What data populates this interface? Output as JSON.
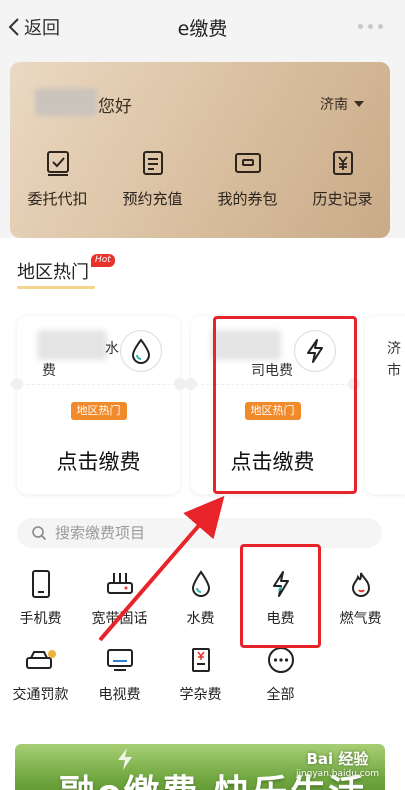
{
  "nav": {
    "back_label": "返回",
    "title": "e缴费"
  },
  "hero": {
    "greeting": "您好",
    "city": "济南",
    "actions": [
      {
        "label": "委托代扣",
        "icon": "check-box-icon"
      },
      {
        "label": "预约充值",
        "icon": "document-icon"
      },
      {
        "label": "我的券包",
        "icon": "coupon-icon"
      },
      {
        "label": "历史记录",
        "icon": "yen-record-icon"
      }
    ]
  },
  "section": {
    "title": "地区热门",
    "hot_tag": "Hot"
  },
  "cards": [
    {
      "name_a": "水",
      "name_b": "费",
      "badge": "地区热门",
      "pay_label": "点击缴费",
      "icon": "water-drop-icon"
    },
    {
      "name_a": "",
      "name_b": "司电费",
      "badge": "地区热门",
      "pay_label": "点击缴费",
      "icon": "lightning-icon"
    },
    {
      "name_a": "济",
      "name_b": "市"
    }
  ],
  "search": {
    "placeholder": "搜索缴费项目"
  },
  "services": [
    {
      "label": "手机费",
      "icon": "phone-icon"
    },
    {
      "label": "宽带固话",
      "icon": "router-icon"
    },
    {
      "label": "水费",
      "icon": "water-drop-icon"
    },
    {
      "label": "电费",
      "icon": "lightning-icon"
    },
    {
      "label": "燃气费",
      "icon": "flame-icon"
    },
    {
      "label": "交通罚款",
      "icon": "car-icon"
    },
    {
      "label": "电视费",
      "icon": "tv-icon"
    },
    {
      "label": "学杂费",
      "icon": "tuition-icon"
    },
    {
      "label": "全部",
      "icon": "more-icon"
    }
  ],
  "banner": {
    "text": "融e缴费 快乐生活",
    "watermark_a": "Bai 经验",
    "watermark_b": "jingyan.baidu.com"
  },
  "colors": {
    "hero_gold": "#d9bf9f",
    "badge_orange": "#f08a2a",
    "hot_red": "#e8322b",
    "highlight_red": "#e8242a"
  }
}
